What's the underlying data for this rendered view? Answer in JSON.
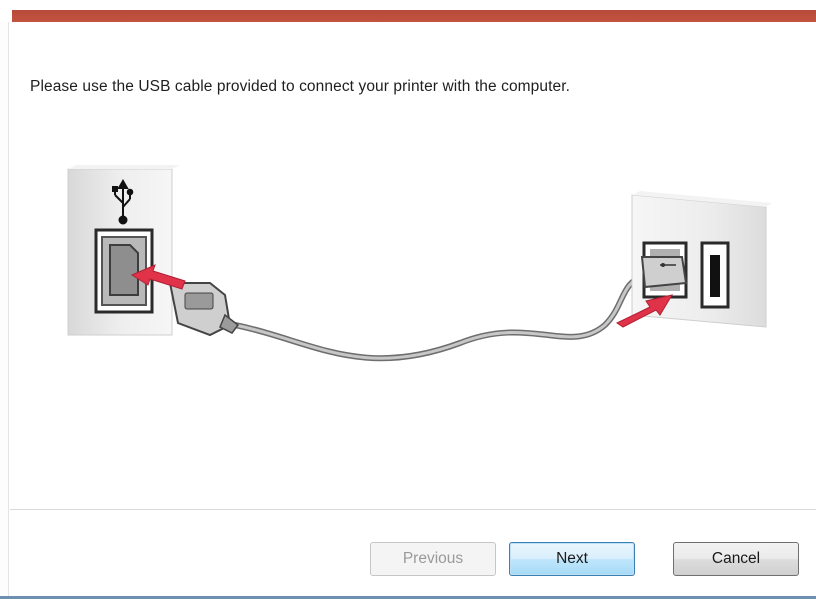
{
  "dialog": {
    "instruction": "Please use the USB cable provided to connect your printer with the computer."
  },
  "illustration": {
    "usb_symbol_icon": "usb-trident-icon"
  },
  "buttons": {
    "previous": "Previous",
    "next": "Next",
    "cancel": "Cancel"
  },
  "colors": {
    "accent_bar": "#c1533f",
    "arrow": "#e0334a",
    "default_button_border": "#3c7fb1"
  }
}
